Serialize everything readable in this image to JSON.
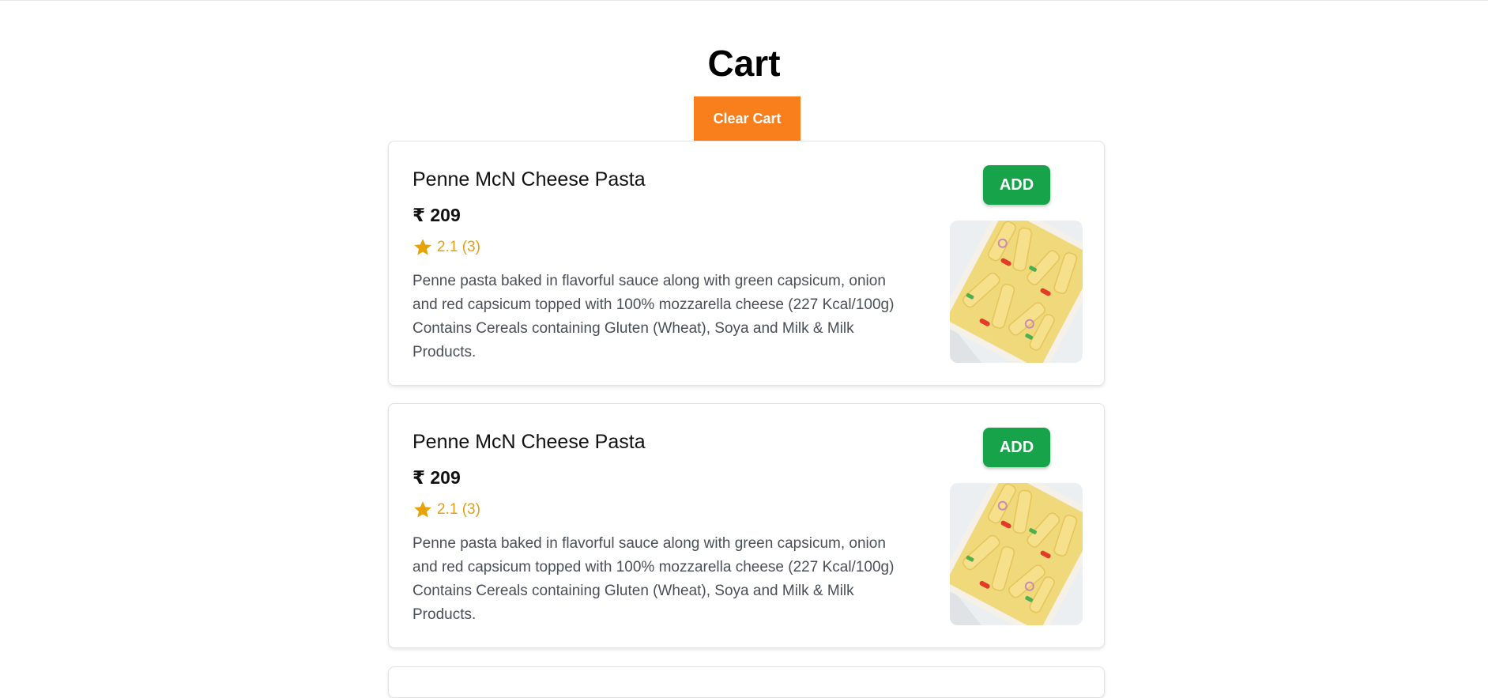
{
  "page": {
    "title": "Cart"
  },
  "actions": {
    "clear_cart_label": "Clear Cart"
  },
  "cart": {
    "items": [
      {
        "name": "Penne McN Cheese Pasta",
        "price": "₹ 209",
        "rating": "2.1 (3)",
        "description": "Penne pasta baked in flavorful sauce along with green capsicum, onion and red capsicum topped with 100% mozzarella cheese (227 Kcal/100g) Contains Cereals containing Gluten (Wheat), Soya and Milk & Milk Products.",
        "add_label": "ADD",
        "image_icon": "pasta-dish-image"
      },
      {
        "name": "Penne McN Cheese Pasta",
        "price": "₹ 209",
        "rating": "2.1 (3)",
        "description": "Penne pasta baked in flavorful sauce along with green capsicum, onion and red capsicum topped with 100% mozzarella cheese (227 Kcal/100g) Contains Cereals containing Gluten (Wheat), Soya and Milk & Milk Products.",
        "add_label": "ADD",
        "image_icon": "pasta-dish-image"
      }
    ]
  },
  "colors": {
    "clear_button": "#f97f1c",
    "add_button": "#16a34a",
    "rating": "#e3a10f"
  }
}
